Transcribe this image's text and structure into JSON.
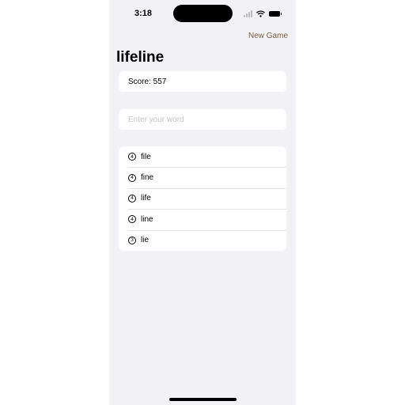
{
  "status_bar": {
    "time": "3:18"
  },
  "nav": {
    "new_game_label": "New Game"
  },
  "title": "lifeline",
  "score": {
    "text": "Score: 557"
  },
  "input": {
    "placeholder": "Enter your word",
    "value": ""
  },
  "words": [
    {
      "count": "4",
      "word": "file"
    },
    {
      "count": "4",
      "word": "fine"
    },
    {
      "count": "4",
      "word": "life"
    },
    {
      "count": "4",
      "word": "line"
    },
    {
      "count": "3",
      "word": "lie"
    }
  ],
  "colors": {
    "background": "#f2f1f6",
    "card": "#ffffff",
    "accent": "#7a5a3c",
    "placeholder": "#c4c4c8"
  },
  "icons": {
    "signal": "cellular-signal-icon",
    "wifi": "wifi-icon",
    "battery": "battery-icon",
    "count_badge": "circled-number-icon"
  }
}
